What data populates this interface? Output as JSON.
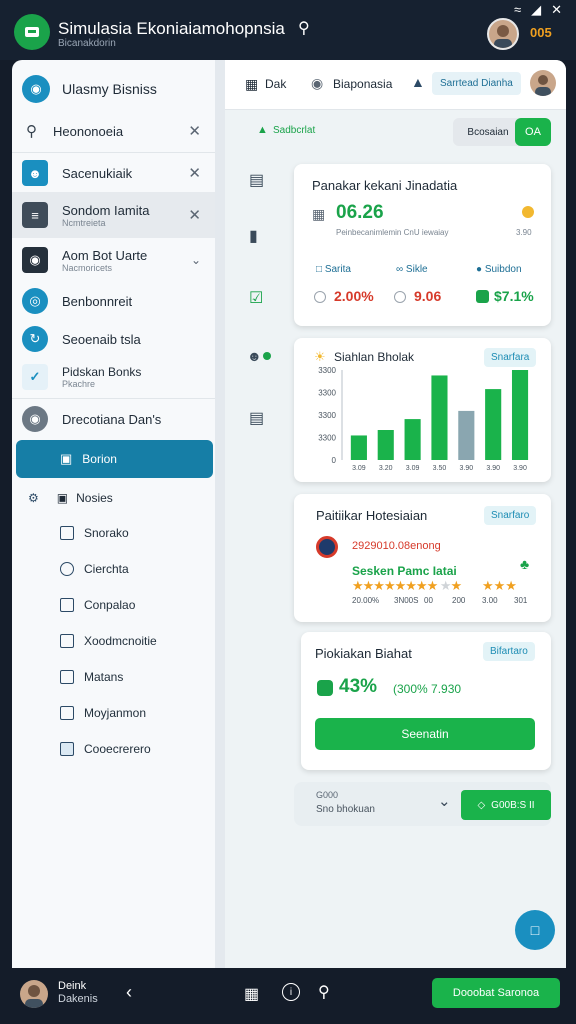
{
  "app": {
    "title": "Simulasia Ekoniaiamohopnsia",
    "subtitle": "Bicanakdorin",
    "badge": "005"
  },
  "sidebar": {
    "header": "Ulasmy Bisniss",
    "search_value": "Heononoeia",
    "items": [
      {
        "label": "Sacenukiaik"
      },
      {
        "label": "Sondom Iamita",
        "sub": "Ncmtreieta"
      },
      {
        "label": "Aom Bot Uarte",
        "sub": "Nacmoricets"
      },
      {
        "label": "Benbonnreit"
      },
      {
        "label": "Seoenaib tsla"
      },
      {
        "label": "Pidskan Bonks",
        "sub": "Pkachre"
      },
      {
        "label": "Drecotiana Dan's"
      },
      {
        "label": "Borion"
      }
    ],
    "group": "Nosies",
    "subitems": [
      "Snorako",
      "Cierchta",
      "Conpalao",
      "Xoodmcnoitie",
      "Matans",
      "Moyjanmon",
      "Cooecrerero"
    ]
  },
  "main": {
    "tabs": [
      "Dak",
      "Biaponasia",
      "Sarrtead Dianha"
    ],
    "breadcrumb": "Sadbcrlat",
    "btn_secondary": "Bcosaian",
    "btn_primary": "OA",
    "card1": {
      "title": "Panakar kekani Jinadatia",
      "value": "06.26",
      "desc": "Peinbecanimlemin CnU iewaiay",
      "side_value": "3.90",
      "metrics": [
        {
          "label": "Sarita",
          "value": "2.00%"
        },
        {
          "label": "Sikle",
          "value": "9.06"
        },
        {
          "label": "Suibdon",
          "value": "$7.1%"
        }
      ]
    },
    "card2": {
      "title": "Siahlan Bholak",
      "pill": "Snarfara",
      "yticks": [
        "3300",
        "3300",
        "3300",
        "3300",
        "0"
      ],
      "xticks": [
        "3.09",
        "3.20",
        "3.09",
        "3.50",
        "3.90",
        "3.90",
        "3.90"
      ]
    },
    "card3": {
      "title": "Paitiikar Hotesiaian",
      "pill": "Snarfaro",
      "link": "2929010.08enong",
      "subtitle": "Sesken Pamc Iatai",
      "cols": [
        "20.00%",
        "3N00S",
        "00",
        "200",
        "3.00",
        "301"
      ]
    },
    "card4": {
      "title": "Piokiakan Biahat",
      "pill": "Bifartaro",
      "pct": "43%",
      "pct_detail": "(300% 7.930",
      "button": "Seenatin"
    },
    "footer": {
      "line1": "G000",
      "line2": "Sno bhokuan",
      "btn": "G00B:S II"
    }
  },
  "bottom": {
    "name": "Deink",
    "sub": "Dakenis",
    "action": "Dooobat Saronoa"
  },
  "chart_data": {
    "type": "bar",
    "categories": [
      "3.09",
      "3.20",
      "3.09",
      "3.50",
      "3.90",
      "3.90",
      "3.90"
    ],
    "series": [
      {
        "values": [
          900,
          1100,
          1500,
          3100,
          1800,
          2600,
          3300
        ]
      }
    ],
    "ylim": [
      0,
      3300
    ]
  }
}
